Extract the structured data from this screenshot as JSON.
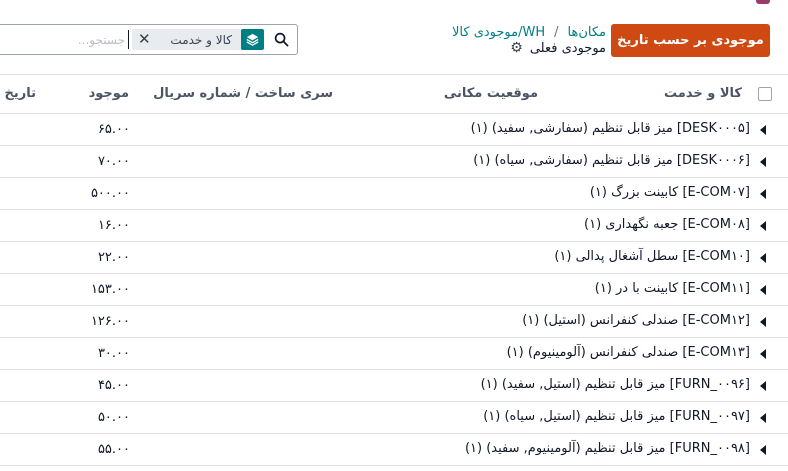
{
  "control_panel": {
    "primary_button": "موجودی بر حسب تاریخ",
    "breadcrumb": [
      "مکان‌ها",
      "WH/موجودی کالا"
    ],
    "title": "موجودی فعلی"
  },
  "search": {
    "facet_label": "کالا و خدمت",
    "placeholder": "جستجو..."
  },
  "table": {
    "columns": {
      "product": "کالا و خدمت",
      "location": "موقعیت مکانی",
      "lot": "سری ساخت / شماره سریال",
      "on_hand": "موجود",
      "date": "تاریخ ورود"
    },
    "rows": [
      {
        "name": "[DESK۰۰۰۵] میز قابل تنظیم (سفارشی, سفید) (۱)",
        "qty": "۶۵.۰۰"
      },
      {
        "name": "[DESK۰۰۰۶] میز قابل تنظیم (سفارشی, سیاه) (۱)",
        "qty": "۷۰.۰۰"
      },
      {
        "name": "[E-COM۰۷] کابینت بزرگ (۱)",
        "qty": "۵۰۰.۰۰"
      },
      {
        "name": "[E-COM۰۸] جعبه نگهداری (۱)",
        "qty": "۱۶.۰۰"
      },
      {
        "name": "[E-COM۱۰] سطل آشغال پدالی (۱)",
        "qty": "۲۲.۰۰"
      },
      {
        "name": "[E-COM۱۱] کابینت با در (۱)",
        "qty": "۱۵۳.۰۰"
      },
      {
        "name": "[E-COM۱۲] صندلی کنفرانس (استیل) (۱)",
        "qty": "۱۲۶.۰۰"
      },
      {
        "name": "[E-COM۱۳] صندلی کنفرانس (آلومینیوم) (۱)",
        "qty": "۳۰.۰۰"
      },
      {
        "name": "[FURN_۰۰۹۶] میز قابل تنظیم (استیل, سفید) (۱)",
        "qty": "۴۵.۰۰"
      },
      {
        "name": "[FURN_۰۰۹۷] میز قابل تنظیم (استیل, سیاه) (۱)",
        "qty": "۵۰.۰۰"
      },
      {
        "name": "[FURN_۰۰۹۸] میز قابل تنظیم (آلومینیوم, سفید) (۱)",
        "qty": "۵۵.۰۰"
      }
    ]
  },
  "colors": {
    "primary": "#cf4a12",
    "link": "#017e84"
  }
}
